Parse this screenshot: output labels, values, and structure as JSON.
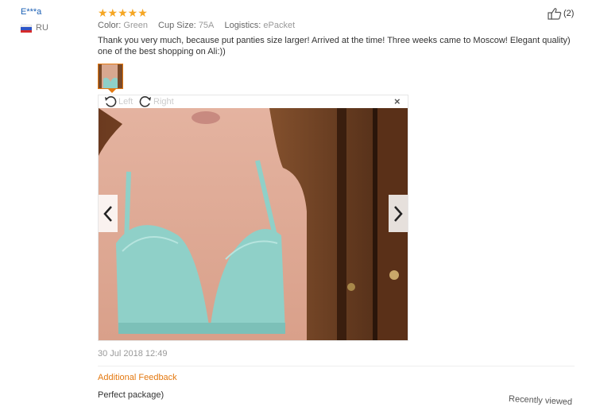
{
  "reviewer": {
    "name": "E***a",
    "country": "RU"
  },
  "rating": {
    "stars": "★★★★★",
    "color": "#f5a623"
  },
  "attributes": [
    {
      "key": "Color:",
      "value": "Green"
    },
    {
      "key": "Cup Size:",
      "value": "75A"
    },
    {
      "key": "Logistics:",
      "value": "ePacket"
    }
  ],
  "helpful": {
    "count": "(2)",
    "icon": "thumbs-up-icon"
  },
  "review_text": "Thank you very much, because put panties size larger! Arrived at the time! Three weeks came to Moscow! Elegant quality) one of the best shopping on Ali:))",
  "viewer": {
    "rotate_left_label": "Left",
    "rotate_right_label": "Right",
    "close_glyph": "×",
    "prev_glyph": "‹",
    "next_glyph": "›"
  },
  "date": "30 Jul 2018 12:49",
  "additional_feedback": {
    "title": "Additional Feedback",
    "text": "Perfect package)"
  },
  "recently_viewed": "Recently viewed",
  "colors": {
    "accent": "#e47911",
    "link": "#1a5fb4",
    "muted": "#999999"
  }
}
